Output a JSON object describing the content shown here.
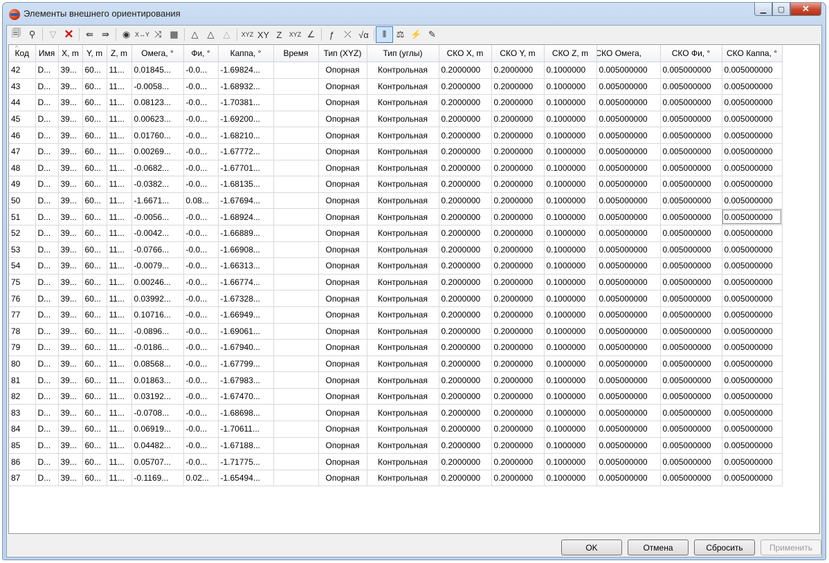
{
  "window": {
    "title": "Элементы внешнего ориентирования",
    "min": "▁",
    "max": "▢",
    "close": "✕"
  },
  "toolbar": [
    {
      "icon": "import-icon",
      "glyph": "🗐",
      "state": "normal"
    },
    {
      "icon": "binoculars-icon",
      "glyph": "⚲",
      "state": "normal"
    },
    {
      "sep": true
    },
    {
      "icon": "filter-icon",
      "glyph": "▽",
      "state": "disabled"
    },
    {
      "icon": "delete-icon",
      "glyph": "✕",
      "state": "normal",
      "color": "#d01010"
    },
    {
      "sep": true
    },
    {
      "icon": "copy-from-icon",
      "glyph": "⇚",
      "state": "normal"
    },
    {
      "icon": "copy-to-icon",
      "glyph": "⇛",
      "state": "normal"
    },
    {
      "sep": true
    },
    {
      "icon": "camera-globe-icon",
      "glyph": "◉",
      "state": "normal"
    },
    {
      "icon": "swap-xy-icon",
      "glyph": "X↔Y",
      "state": "normal"
    },
    {
      "icon": "transform-icon",
      "glyph": "⤨",
      "state": "normal"
    },
    {
      "icon": "grid-settings-icon",
      "glyph": "▦",
      "state": "normal"
    },
    {
      "sep": true
    },
    {
      "icon": "add-triangle-icon",
      "glyph": "△",
      "state": "normal"
    },
    {
      "icon": "add-triangle-2-icon",
      "glyph": "△",
      "state": "normal"
    },
    {
      "icon": "add-triangle-3-icon",
      "glyph": "△",
      "state": "disabled"
    },
    {
      "sep": true
    },
    {
      "icon": "xyz-icon",
      "glyph": "XYZ",
      "state": "normal"
    },
    {
      "icon": "xy-icon",
      "glyph": "XY",
      "state": "normal"
    },
    {
      "icon": "z-icon",
      "glyph": "Z",
      "state": "normal"
    },
    {
      "icon": "xyz-table-icon",
      "glyph": "XYZ",
      "state": "normal"
    },
    {
      "icon": "angle-icon",
      "glyph": "∠",
      "state": "normal"
    },
    {
      "sep": true
    },
    {
      "icon": "formula-icon",
      "glyph": "ƒ",
      "state": "normal"
    },
    {
      "icon": "axis-icon",
      "glyph": "⤫",
      "state": "normal"
    },
    {
      "icon": "sqrt-icon",
      "glyph": "√α",
      "state": "normal"
    },
    {
      "sep": true
    },
    {
      "icon": "columns-icon",
      "glyph": "⦀",
      "state": "selected"
    },
    {
      "icon": "balance-icon",
      "glyph": "⚖",
      "state": "normal"
    },
    {
      "icon": "lightning-icon",
      "glyph": "⚡",
      "state": "normal"
    },
    {
      "icon": "tool-icon",
      "glyph": "✎",
      "state": "normal"
    }
  ],
  "columns": [
    {
      "label": "Код",
      "w": 38
    },
    {
      "label": "Имя",
      "w": 33
    },
    {
      "label": "X, m",
      "w": 35
    },
    {
      "label": "Y, m",
      "w": 35
    },
    {
      "label": "Z, m",
      "w": 36
    },
    {
      "label": "Омега, °",
      "w": 75
    },
    {
      "label": "Фи, °",
      "w": 50
    },
    {
      "label": "Каппа, °",
      "w": 80
    },
    {
      "label": "Время",
      "w": 65
    },
    {
      "label": "Тип (XYZ)",
      "w": 70
    },
    {
      "label": "Тип (углы)",
      "w": 104
    },
    {
      "label": "СКО X, m",
      "w": 76
    },
    {
      "label": "СКО Y, m",
      "w": 76
    },
    {
      "label": "СКО Z, m",
      "w": 76
    },
    {
      "label": "СКО Омега,",
      "w": 92
    },
    {
      "label": "СКО Фи, °",
      "w": 89
    },
    {
      "label": "СКО Каппа, °",
      "w": 87
    }
  ],
  "rows": [
    [
      "42",
      "D...",
      "39...",
      "60...",
      "11...",
      "0.01845...",
      "-0.0...",
      "-1.69824...",
      "",
      "Опорная",
      "Контрольная",
      "0.2000000",
      "0.2000000",
      "0.1000000",
      "0.005000000",
      "0.005000000",
      "0.005000000"
    ],
    [
      "43",
      "D...",
      "39...",
      "60...",
      "11...",
      "-0.0058...",
      "-0.0...",
      "-1.68932...",
      "",
      "Опорная",
      "Контрольная",
      "0.2000000",
      "0.2000000",
      "0.1000000",
      "0.005000000",
      "0.005000000",
      "0.005000000"
    ],
    [
      "44",
      "D...",
      "39...",
      "60...",
      "11...",
      "0.08123...",
      "-0.0...",
      "-1.70381...",
      "",
      "Опорная",
      "Контрольная",
      "0.2000000",
      "0.2000000",
      "0.1000000",
      "0.005000000",
      "0.005000000",
      "0.005000000"
    ],
    [
      "45",
      "D...",
      "39...",
      "60...",
      "11...",
      "0.00623...",
      "-0.0...",
      "-1.69200...",
      "",
      "Опорная",
      "Контрольная",
      "0.2000000",
      "0.2000000",
      "0.1000000",
      "0.005000000",
      "0.005000000",
      "0.005000000"
    ],
    [
      "46",
      "D...",
      "39...",
      "60...",
      "11...",
      "0.01760...",
      "-0.0...",
      "-1.68210...",
      "",
      "Опорная",
      "Контрольная",
      "0.2000000",
      "0.2000000",
      "0.1000000",
      "0.005000000",
      "0.005000000",
      "0.005000000"
    ],
    [
      "47",
      "D...",
      "39...",
      "60...",
      "11...",
      "0.00269...",
      "-0.0...",
      "-1.67772...",
      "",
      "Опорная",
      "Контрольная",
      "0.2000000",
      "0.2000000",
      "0.1000000",
      "0.005000000",
      "0.005000000",
      "0.005000000"
    ],
    [
      "48",
      "D...",
      "39...",
      "60...",
      "11...",
      "-0.0682...",
      "-0.0...",
      "-1.67701...",
      "",
      "Опорная",
      "Контрольная",
      "0.2000000",
      "0.2000000",
      "0.1000000",
      "0.005000000",
      "0.005000000",
      "0.005000000"
    ],
    [
      "49",
      "D...",
      "39...",
      "60...",
      "11...",
      "-0.0382...",
      "-0.0...",
      "-1.68135...",
      "",
      "Опорная",
      "Контрольная",
      "0.2000000",
      "0.2000000",
      "0.1000000",
      "0.005000000",
      "0.005000000",
      "0.005000000"
    ],
    [
      "50",
      "D...",
      "39...",
      "60...",
      "11...",
      "-1.6671...",
      "0.08...",
      "-1.67694...",
      "",
      "Опорная",
      "Контрольная",
      "0.2000000",
      "0.2000000",
      "0.1000000",
      "0.005000000",
      "0.005000000",
      "0.005000000"
    ],
    [
      "51",
      "D...",
      "39...",
      "60...",
      "11...",
      "-0.0056...",
      "-0.0...",
      "-1.68924...",
      "",
      "Опорная",
      "Контрольная",
      "0.2000000",
      "0.2000000",
      "0.1000000",
      "0.005000000",
      "0.005000000",
      "0.005000000"
    ],
    [
      "52",
      "D...",
      "39...",
      "60...",
      "11...",
      "-0.0042...",
      "-0.0...",
      "-1.66889...",
      "",
      "Опорная",
      "Контрольная",
      "0.2000000",
      "0.2000000",
      "0.1000000",
      "0.005000000",
      "0.005000000",
      "0.005000000"
    ],
    [
      "53",
      "D...",
      "39...",
      "60...",
      "11...",
      "-0.0766...",
      "-0.0...",
      "-1.66908...",
      "",
      "Опорная",
      "Контрольная",
      "0.2000000",
      "0.2000000",
      "0.1000000",
      "0.005000000",
      "0.005000000",
      "0.005000000"
    ],
    [
      "54",
      "D...",
      "39...",
      "60...",
      "11...",
      "-0.0079...",
      "-0.0...",
      "-1.66313...",
      "",
      "Опорная",
      "Контрольная",
      "0.2000000",
      "0.2000000",
      "0.1000000",
      "0.005000000",
      "0.005000000",
      "0.005000000"
    ],
    [
      "75",
      "D...",
      "39...",
      "60...",
      "11...",
      "0.00246...",
      "-0.0...",
      "-1.66774...",
      "",
      "Опорная",
      "Контрольная",
      "0.2000000",
      "0.2000000",
      "0.1000000",
      "0.005000000",
      "0.005000000",
      "0.005000000"
    ],
    [
      "76",
      "D...",
      "39...",
      "60...",
      "11...",
      "0.03992...",
      "-0.0...",
      "-1.67328...",
      "",
      "Опорная",
      "Контрольная",
      "0.2000000",
      "0.2000000",
      "0.1000000",
      "0.005000000",
      "0.005000000",
      "0.005000000"
    ],
    [
      "77",
      "D...",
      "39...",
      "60...",
      "11...",
      "0.10716...",
      "-0.0...",
      "-1.66949...",
      "",
      "Опорная",
      "Контрольная",
      "0.2000000",
      "0.2000000",
      "0.1000000",
      "0.005000000",
      "0.005000000",
      "0.005000000"
    ],
    [
      "78",
      "D...",
      "39...",
      "60...",
      "11...",
      "-0.0896...",
      "-0.0...",
      "-1.69061...",
      "",
      "Опорная",
      "Контрольная",
      "0.2000000",
      "0.2000000",
      "0.1000000",
      "0.005000000",
      "0.005000000",
      "0.005000000"
    ],
    [
      "79",
      "D...",
      "39...",
      "60...",
      "11...",
      "-0.0186...",
      "-0.0...",
      "-1.67940...",
      "",
      "Опорная",
      "Контрольная",
      "0.2000000",
      "0.2000000",
      "0.1000000",
      "0.005000000",
      "0.005000000",
      "0.005000000"
    ],
    [
      "80",
      "D...",
      "39...",
      "60...",
      "11...",
      "0.08568...",
      "-0.0...",
      "-1.67799...",
      "",
      "Опорная",
      "Контрольная",
      "0.2000000",
      "0.2000000",
      "0.1000000",
      "0.005000000",
      "0.005000000",
      "0.005000000"
    ],
    [
      "81",
      "D...",
      "39...",
      "60...",
      "11...",
      "0.01863...",
      "-0.0...",
      "-1.67983...",
      "",
      "Опорная",
      "Контрольная",
      "0.2000000",
      "0.2000000",
      "0.1000000",
      "0.005000000",
      "0.005000000",
      "0.005000000"
    ],
    [
      "82",
      "D...",
      "39...",
      "60...",
      "11...",
      "0.03192...",
      "-0.0...",
      "-1.67470...",
      "",
      "Опорная",
      "Контрольная",
      "0.2000000",
      "0.2000000",
      "0.1000000",
      "0.005000000",
      "0.005000000",
      "0.005000000"
    ],
    [
      "83",
      "D...",
      "39...",
      "60...",
      "11...",
      "-0.0708...",
      "-0.0...",
      "-1.68698...",
      "",
      "Опорная",
      "Контрольная",
      "0.2000000",
      "0.2000000",
      "0.1000000",
      "0.005000000",
      "0.005000000",
      "0.005000000"
    ],
    [
      "84",
      "D...",
      "39...",
      "60...",
      "11...",
      "0.06919...",
      "-0.0...",
      "-1.70611...",
      "",
      "Опорная",
      "Контрольная",
      "0.2000000",
      "0.2000000",
      "0.1000000",
      "0.005000000",
      "0.005000000",
      "0.005000000"
    ],
    [
      "85",
      "D...",
      "39...",
      "60...",
      "11...",
      "0.04482...",
      "-0.0...",
      "-1.67188...",
      "",
      "Опорная",
      "Контрольная",
      "0.2000000",
      "0.2000000",
      "0.1000000",
      "0.005000000",
      "0.005000000",
      "0.005000000"
    ],
    [
      "86",
      "D...",
      "39...",
      "60...",
      "11...",
      "0.05707...",
      "-0.0...",
      "-1.71775...",
      "",
      "Опорная",
      "Контрольная",
      "0.2000000",
      "0.2000000",
      "0.1000000",
      "0.005000000",
      "0.005000000",
      "0.005000000"
    ],
    [
      "87",
      "D...",
      "39...",
      "60...",
      "11...",
      "-0.1169...",
      "0.02...",
      "-1.65494...",
      "",
      "Опорная",
      "Контрольная",
      "0.2000000",
      "0.2000000",
      "0.1000000",
      "0.005000000",
      "0.005000000",
      "0.005000000"
    ]
  ],
  "focused_cell": {
    "row": 9,
    "col": 16
  },
  "buttons": {
    "ok": "OK",
    "cancel": "Отмена",
    "reset": "Сбросить",
    "apply": "Применить"
  }
}
